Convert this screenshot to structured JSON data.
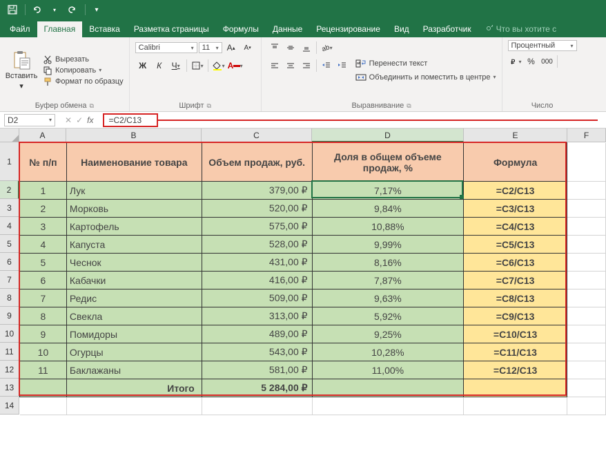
{
  "titlebar": {
    "save_icon": "save",
    "undo_icon": "undo",
    "redo_icon": "redo"
  },
  "tabs": {
    "file": "Файл",
    "home": "Главная",
    "insert": "Вставка",
    "layout": "Разметка страницы",
    "formulas": "Формулы",
    "data": "Данные",
    "review": "Рецензирование",
    "view": "Вид",
    "developer": "Разработчик",
    "tell": "Что вы хотите с"
  },
  "ribbon": {
    "clipboard": {
      "paste": "Вставить",
      "cut": "Вырезать",
      "copy": "Копировать",
      "format": "Формат по образцу",
      "label": "Буфер обмена"
    },
    "font": {
      "name": "Calibri",
      "size": "11",
      "bold": "Ж",
      "italic": "К",
      "underline": "Ч",
      "label": "Шрифт"
    },
    "alignment": {
      "wrap": "Перенести текст",
      "merge": "Объединить и поместить в центре",
      "label": "Выравнивание"
    },
    "number": {
      "format": "Процентный",
      "label": "Число"
    }
  },
  "formula_bar": {
    "namebox": "D2",
    "fx": "fx",
    "formula": "=C2/C13"
  },
  "columns": {
    "widths": [
      68,
      196,
      160,
      220,
      150,
      56
    ],
    "labels": [
      "A",
      "B",
      "C",
      "D",
      "E",
      "F"
    ]
  },
  "header_row_height": 56,
  "data_row_height": 26,
  "row_labels": [
    "1",
    "2",
    "3",
    "4",
    "5",
    "6",
    "7",
    "8",
    "9",
    "10",
    "11",
    "12",
    "13",
    "14"
  ],
  "headers": {
    "a": "№ п/п",
    "b": "Наименование товара",
    "c": "Объем продаж, руб.",
    "d": "Доля в общем объеме продаж, %",
    "e": "Формула"
  },
  "rows": [
    {
      "n": "1",
      "name": "Лук",
      "vol": "379,00 ₽",
      "share": "7,17%",
      "formula": "=C2/C13"
    },
    {
      "n": "2",
      "name": "Морковь",
      "vol": "520,00 ₽",
      "share": "9,84%",
      "formula": "=C3/C13"
    },
    {
      "n": "3",
      "name": "Картофель",
      "vol": "575,00 ₽",
      "share": "10,88%",
      "formula": "=C4/C13"
    },
    {
      "n": "4",
      "name": "Капуста",
      "vol": "528,00 ₽",
      "share": "9,99%",
      "formula": "=C5/C13"
    },
    {
      "n": "5",
      "name": "Чеснок",
      "vol": "431,00 ₽",
      "share": "8,16%",
      "formula": "=C6/C13"
    },
    {
      "n": "6",
      "name": "Кабачки",
      "vol": "416,00 ₽",
      "share": "7,87%",
      "formula": "=C7/C13"
    },
    {
      "n": "7",
      "name": "Редис",
      "vol": "509,00 ₽",
      "share": "9,63%",
      "formula": "=C8/C13"
    },
    {
      "n": "8",
      "name": "Свекла",
      "vol": "313,00 ₽",
      "share": "5,92%",
      "formula": "=C9/C13"
    },
    {
      "n": "9",
      "name": "Помидоры",
      "vol": "489,00 ₽",
      "share": "9,25%",
      "formula": "=C10/C13"
    },
    {
      "n": "10",
      "name": "Огурцы",
      "vol": "543,00 ₽",
      "share": "10,28%",
      "formula": "=C11/C13"
    },
    {
      "n": "11",
      "name": "Баклажаны",
      "vol": "581,00 ₽",
      "share": "11,00%",
      "formula": "=C12/C13"
    }
  ],
  "total": {
    "label": "Итого",
    "vol": "5 284,00 ₽"
  },
  "selected_cell": "D2"
}
